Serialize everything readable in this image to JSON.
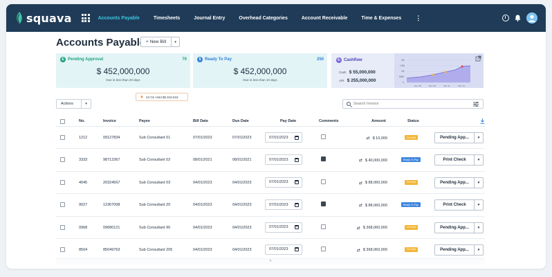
{
  "app": {
    "logo_text": "squava",
    "nav": [
      "Accounts Payable",
      "Timesheets",
      "Journal Entry",
      "Overhead Categories",
      "Account Receivable",
      "Time & Expenses"
    ],
    "nav_more": "⋮",
    "brand_color": "#1f3b57",
    "active_color": "#3ec7e0"
  },
  "page": {
    "title": "Accounts Payable",
    "new_bill_label": "+ New Bill",
    "caret": "▾"
  },
  "summary": {
    "pending": {
      "icon_letter": "E",
      "label": "Pending Approval",
      "count": "70",
      "amount": "$ 452,000,000",
      "sub": "Due in less than 20 days",
      "color": "#1fa37a"
    },
    "ready": {
      "icon_letter": "$",
      "label": "Ready To Pay",
      "count": "250",
      "amount": "$ 452,000,000",
      "sub": "Due in less than 10 days",
      "color": "#2f7fd6"
    },
    "hold": {
      "icon": "warning-icon",
      "text": "43 On Hold  $5,919,918"
    },
    "cashflow": {
      "label": "Cashflow",
      "rows": [
        {
          "label": "Cash",
          "value": "$ 55,000,000"
        },
        {
          "label": "A/R",
          "value": "$ 255,000,000"
        }
      ],
      "chart_data": {
        "type": "area",
        "y_ticks": [
          "1M",
          "1.5M",
          "1M",
          "500K",
          "0"
        ],
        "x_ticks": [
          "Nov '20",
          "Dec '20",
          "Jan '21",
          "Feb '21"
        ],
        "title": "",
        "xlabel": "",
        "ylabel": "",
        "grid": true
      }
    }
  },
  "toolbar": {
    "actions_label": "Actions",
    "search_placeholder": "Search Invoice"
  },
  "table": {
    "headers": [
      "No.",
      "Invoice",
      "Payee",
      "Bill Date",
      "Due Date",
      "Pay Date",
      "Comments",
      "Amount",
      "Status"
    ],
    "rows": [
      {
        "no": "1212",
        "invoice": "09127834",
        "payee": "Sub Consultant 01",
        "bill_date": "07/01/2023",
        "due_date": "07/01/2023",
        "pay_date": "07/01/2023",
        "comment_filled": false,
        "amount": "$ 10,000",
        "status": "On Hold",
        "action": "Pending App..."
      },
      {
        "no": "3333",
        "invoice": "98712367",
        "payee": "Sub Consultant 02",
        "bill_date": "08/01/2021",
        "due_date": "08/01/2021",
        "pay_date": "07/01/2023",
        "comment_filled": true,
        "amount": "$ 40,000,000",
        "status": "Ready To Pay",
        "action": "Print Check"
      },
      {
        "no": "4045",
        "invoice": "20324567",
        "payee": "Sub Consultant 03",
        "bill_date": "04/01/2023",
        "due_date": "04/01/2023",
        "pay_date": "07/01/2023",
        "comment_filled": false,
        "amount": "$ 88,060,000",
        "status": "On Hold",
        "action": "Pending App..."
      },
      {
        "no": "9027",
        "invoice": "12367008",
        "payee": "Sub Consultant 20",
        "bill_date": "04/01/2023",
        "due_date": "04/01/2023",
        "pay_date": "07/01/2023",
        "comment_filled": true,
        "amount": "$ 88,060,000",
        "status": "Ready To Pay",
        "action": "Print Check"
      },
      {
        "no": "0968",
        "invoice": "09680121",
        "payee": "Sub Consultant 90",
        "bill_date": "04/01/2023",
        "due_date": "04/01/2023",
        "pay_date": "07/01/2023",
        "comment_filled": false,
        "amount": "$ 368,060,000",
        "status": "On Hold",
        "action": "Pending App..."
      },
      {
        "no": "8504",
        "invoice": "85049763",
        "payee": "Sub Consultant 205",
        "bill_date": "04/01/2023",
        "due_date": "04/01/2023",
        "pay_date": "07/01/2023",
        "comment_filled": false,
        "amount": "$ 368,060,000",
        "status": "On Hold",
        "action": "Pending App..."
      }
    ],
    "status_colors": {
      "On Hold": "#f2b63a",
      "Ready To Pay": "#3f86de"
    },
    "swap_glyph": "⇄",
    "scroll_up_glyph": "^"
  }
}
